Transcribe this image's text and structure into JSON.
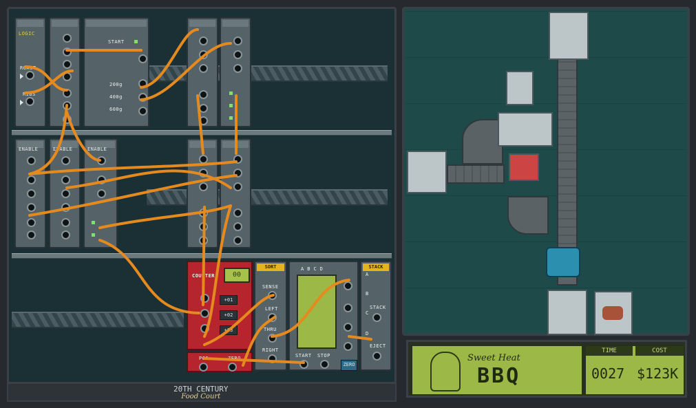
{
  "game": {
    "branding": {
      "line1": "20TH CENTURY",
      "line2": "Food Court"
    },
    "modules": {
      "logic_label": "LOGIC",
      "input_roast": "ROAST",
      "input_ribs": "RIBS",
      "start_label": "START",
      "weights": [
        "200g",
        "400g",
        "600g"
      ],
      "enable_labels": [
        "ENABLE",
        "ENABLE",
        "ENABLE"
      ],
      "counter": {
        "title": "COUNTER",
        "display": "00",
        "steps": [
          "+01",
          "+02",
          "+03"
        ],
        "pos_label": "POS",
        "zero_label": "ZERO"
      },
      "sort": {
        "title": "SORT",
        "sense": "SENSE",
        "left": "LEFT",
        "thru": "THRU",
        "right": "RIGHT"
      },
      "grid": {
        "columns": [
          "A",
          "B",
          "C",
          "D"
        ],
        "start": "START",
        "stop": "STOP",
        "zero": "ZERO"
      },
      "stack": {
        "title": "STACK",
        "stack_label": "STACK",
        "eject_label": "EJECT",
        "ports": [
          "A",
          "B",
          "C",
          "D"
        ]
      }
    },
    "status": {
      "logo_line1": "Sweet Heat",
      "logo_line2": "BBQ",
      "time_label": "TIME",
      "time_value": "0027",
      "cost_label": "COST",
      "cost_value": "$123K"
    },
    "colors": {
      "wire": "#e58a1f",
      "wire_highlight": "#ffcf6a",
      "lcd": "#9cb846",
      "counter_red": "#b6252d",
      "sort_yellow": "#e3b320",
      "floor": "#235252"
    }
  }
}
